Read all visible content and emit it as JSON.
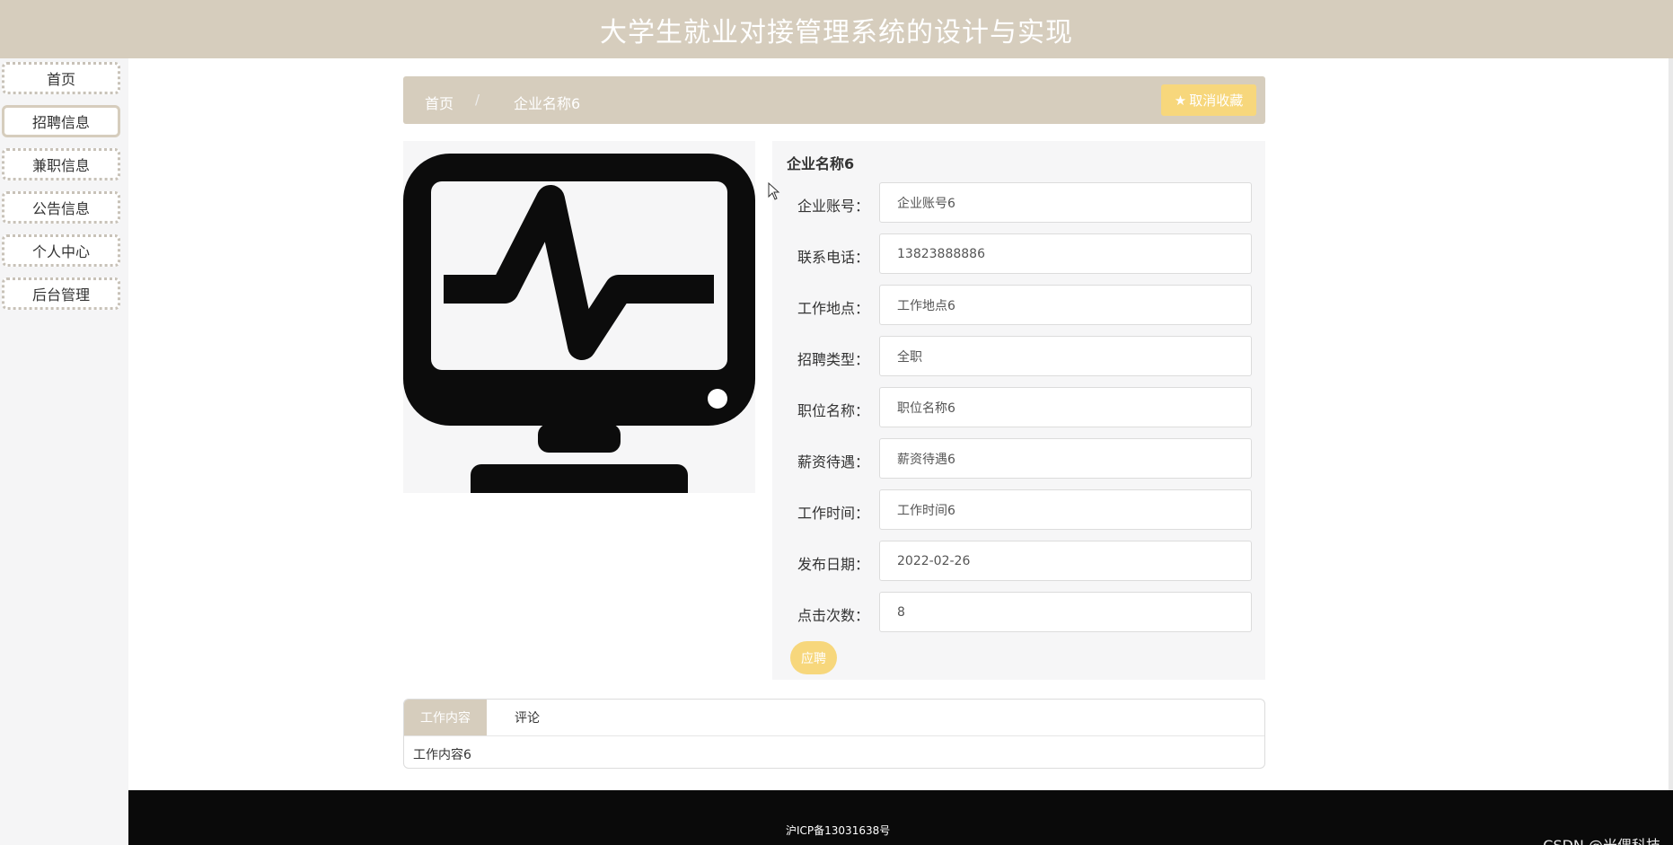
{
  "header": {
    "title": "大学生就业对接管理系统的设计与实现"
  },
  "sidebar": {
    "items": [
      {
        "label": "首页"
      },
      {
        "label": "招聘信息"
      },
      {
        "label": "兼职信息"
      },
      {
        "label": "公告信息"
      },
      {
        "label": "个人中心"
      },
      {
        "label": "后台管理"
      }
    ],
    "active_index": 1
  },
  "breadcrumb": {
    "home": "首页",
    "separator": "/",
    "current": "企业名称6",
    "favorite_button": "取消收藏"
  },
  "image": {
    "icon": "monitor-heartbeat-icon"
  },
  "detail": {
    "title": "企业名称6",
    "fields": [
      {
        "label": "企业账号：",
        "value": "企业账号6"
      },
      {
        "label": "联系电话：",
        "value": "13823888886"
      },
      {
        "label": "工作地点：",
        "value": "工作地点6"
      },
      {
        "label": "招聘类型：",
        "value": "全职"
      },
      {
        "label": "职位名称：",
        "value": "职位名称6"
      },
      {
        "label": "薪资待遇：",
        "value": "薪资待遇6"
      },
      {
        "label": "工作时间：",
        "value": "工作时间6"
      },
      {
        "label": "发布日期：",
        "value": "2022-02-26"
      },
      {
        "label": "点击次数：",
        "value": "8"
      }
    ],
    "apply_button": "应聘"
  },
  "tabs": {
    "items": [
      {
        "label": "工作内容"
      },
      {
        "label": "评论"
      }
    ],
    "content": "工作内容6"
  },
  "footer": {
    "icp": "沪ICP备13031638号"
  },
  "watermark": "CSDN @米偶科技",
  "colors": {
    "primary": "#d6cdbd",
    "accent": "#f7d77c",
    "footer": "#0a0a0a"
  }
}
